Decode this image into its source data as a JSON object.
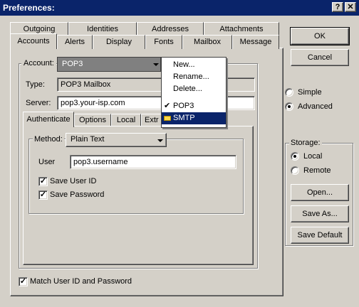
{
  "window": {
    "title": "Preferences:",
    "help_label": "?",
    "close_label": "✕"
  },
  "tabs_back": [
    "Outgoing",
    "Identities",
    "Addresses",
    "Attachments"
  ],
  "tabs_front": [
    "Accounts",
    "Alerts",
    "Display",
    "Fonts",
    "Mailbox",
    "Message"
  ],
  "account": {
    "label": "Account:",
    "value": "POP3",
    "type_label": "Type:",
    "type_value": "POP3 Mailbox",
    "server_label": "Server:",
    "server_value": "pop3.your-isp.com"
  },
  "subtabs": [
    "Authenticate",
    "Options",
    "Local",
    "Extr"
  ],
  "method": {
    "label": "Method:",
    "value": "Plain Text",
    "user_label": "User",
    "user_value": "pop3.username",
    "save_user_id": "Save User ID",
    "save_password": "Save Password"
  },
  "match_label": "Match User ID and Password",
  "dropdown_menu": {
    "new": "New...",
    "rename": "Rename...",
    "delete": "Delete...",
    "pop3": "POP3",
    "smtp": "SMTP",
    "check": "✔"
  },
  "buttons": {
    "ok": "OK",
    "cancel": "Cancel",
    "open": "Open...",
    "save_as": "Save As...",
    "save_default": "Save Default"
  },
  "mode": {
    "simple": "Simple",
    "advanced": "Advanced"
  },
  "storage": {
    "label": "Storage:",
    "local": "Local",
    "remote": "Remote"
  }
}
